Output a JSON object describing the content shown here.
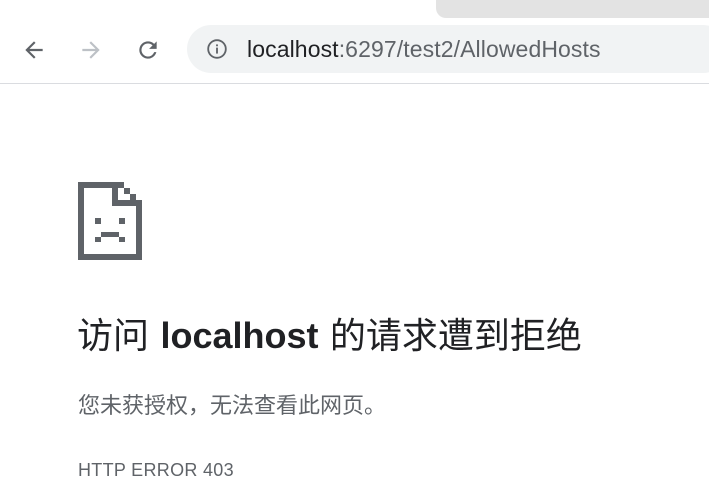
{
  "toolbar": {
    "back_icon": "arrow-left-icon",
    "forward_icon": "arrow-right-icon",
    "reload_icon": "reload-icon",
    "info_icon": "info-circle-icon"
  },
  "address_bar": {
    "host": "localhost",
    "rest": ":6297/test2/AllowedHosts"
  },
  "error_page": {
    "icon": "sad-document-icon",
    "title_prefix": "访问 ",
    "title_host": "localhost",
    "title_suffix": " 的请求遭到拒绝",
    "description": "您未获授权，无法查看此网页。",
    "error_code": "HTTP ERROR 403"
  },
  "colors": {
    "text_primary": "#202124",
    "text_secondary": "#5f6368",
    "omnibox_bg": "#f1f3f4"
  }
}
